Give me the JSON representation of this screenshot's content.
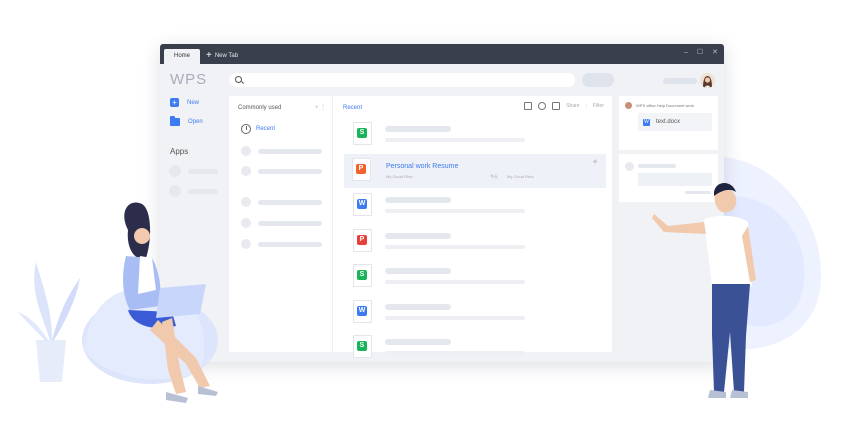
{
  "tabs": [
    {
      "label": "Home"
    },
    {
      "label": "New Tab"
    }
  ],
  "window_controls": {
    "minimize": "–",
    "maximize": "☐",
    "close": "✕"
  },
  "sidebar": {
    "logo": "WPS",
    "new_label": "New",
    "open_label": "Open",
    "apps_heading": "Apps"
  },
  "search": {
    "placeholder": ""
  },
  "commonly_used": {
    "title": "Commonly used",
    "more": "+ ⋮",
    "recent_label": "Recent"
  },
  "recent_panel": {
    "title": "Recent",
    "share_label": "Share",
    "filter_label": "Filter",
    "files": [
      {
        "type": "S",
        "color": "#19b35a"
      },
      {
        "type": "P",
        "color": "#f0632f",
        "name": "Personal work Resume",
        "location": "My Cloud Files",
        "date": "今天",
        "location2": "My Cloud Files",
        "selected": true
      },
      {
        "type": "W",
        "color": "#3d7bf0"
      },
      {
        "type": "P",
        "color": "#e8403c"
      },
      {
        "type": "S",
        "color": "#19b35a"
      },
      {
        "type": "W",
        "color": "#3d7bf0"
      },
      {
        "type": "S",
        "color": "#19b35a"
      }
    ]
  },
  "right_panel": {
    "message": "WPS office Help Document work",
    "doc_name": "text.docx"
  },
  "colors": {
    "accent": "#3d7bf0",
    "titlebar": "#3a3f4c"
  }
}
